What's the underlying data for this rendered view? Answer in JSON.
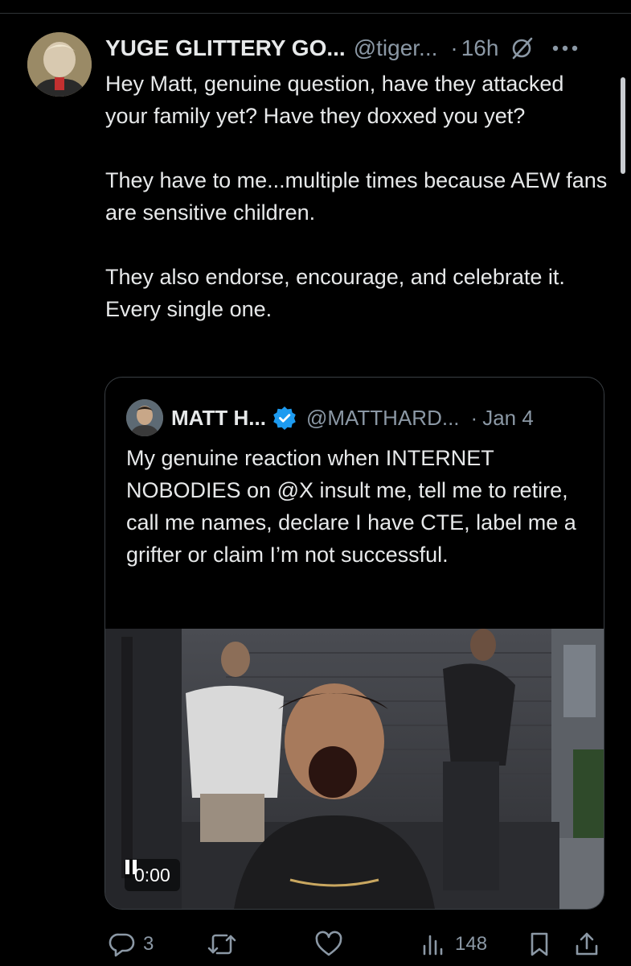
{
  "tweet": {
    "display_name": "YUGE GLITTERY GO...",
    "handle": "@tiger...",
    "separator": "·",
    "time": "16h",
    "paragraphs": [
      "Hey Matt, genuine question, have they attacked your family yet? Have they doxxed you yet?",
      "They have to me...multiple times because AEW fans are sensitive children.",
      "They also endorse, encourage, and celebrate it. Every single one."
    ],
    "icons": {
      "grok": "grok-slash-icon",
      "more": "more-dots-icon"
    }
  },
  "quote": {
    "display_name": "MATT H...",
    "handle": "@MATTHARD...",
    "separator": "·",
    "date": "Jan 4",
    "text": "My genuine reaction when INTERNET NOBODIES on @X insult me, tell me to retire, call me names, declare I have CTE, label me a grifter or claim I’m not successful.",
    "verified_color": "#1d9bf0",
    "video": {
      "timer": "0:00",
      "state_icon": "pause-icon"
    }
  },
  "actions": {
    "replies": "3",
    "views": "148",
    "icons": [
      "reply-icon",
      "repost-icon",
      "like-icon",
      "views-icon",
      "bookmark-icon",
      "share-icon"
    ]
  },
  "colors": {
    "background": "#000000",
    "text": "#e7e9ea",
    "muted": "#8b98a5",
    "accent": "#1d9bf0"
  }
}
